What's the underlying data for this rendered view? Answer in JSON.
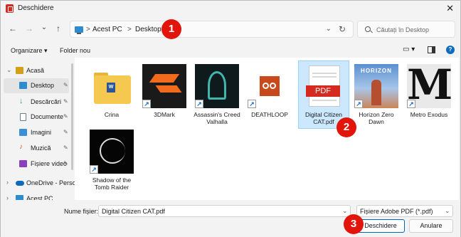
{
  "window": {
    "title": "Deschidere",
    "close_glyph": "✕"
  },
  "nav": {
    "back": "←",
    "forward": "→",
    "recent": "⌄",
    "up": "↑"
  },
  "address": {
    "crumbs": [
      "Acest PC",
      "Desktop"
    ],
    "sep": ">",
    "dropdown": "⌄",
    "refresh": "↻"
  },
  "search": {
    "placeholder": "Căutați în Desktop"
  },
  "toolbar": {
    "organize": "Organizare ▾",
    "new_folder": "Folder nou",
    "view_glyph": "▭ ▾",
    "help_glyph": "?"
  },
  "badges": [
    "1",
    "2",
    "3"
  ],
  "sidebar": {
    "items": [
      {
        "label": "Acasă",
        "icon": "home-icon",
        "color": "#d4a017"
      },
      {
        "label": "Desktop",
        "icon": "desktop-folder-icon",
        "color": "#2c8ccf",
        "selected": true
      },
      {
        "label": "Descărcări",
        "icon": "downloads-icon",
        "color": "#2f9e5b"
      },
      {
        "label": "Documente",
        "icon": "documents-icon",
        "color": "#6a7b8c"
      },
      {
        "label": "Imagini",
        "icon": "pictures-icon",
        "color": "#3a8fd6"
      },
      {
        "label": "Muzică",
        "icon": "music-icon",
        "color": "#e0601f"
      },
      {
        "label": "Fișiere video",
        "icon": "videos-icon",
        "color": "#8a3fbf"
      },
      {
        "label": "OneDrive - Perso",
        "icon": "onedrive-icon",
        "color": "#0f6cbd"
      },
      {
        "label": "Acest PC",
        "icon": "pc-icon",
        "color": "#2c8ccf"
      }
    ],
    "pin_glyph": "📌"
  },
  "files": [
    {
      "name": "Crina",
      "type": "folder"
    },
    {
      "name": "3DMark",
      "type": "shortcut"
    },
    {
      "name": "Assassin's Creed Valhalla",
      "type": "shortcut"
    },
    {
      "name": "DEATHLOOP",
      "type": "shortcut"
    },
    {
      "name": "Digital Citizen CAT.pdf",
      "type": "pdf",
      "selected": true,
      "thumb_text": "PDF"
    },
    {
      "name": "Horizon Zero Dawn",
      "type": "shortcut",
      "thumb_text": "HORIZON"
    },
    {
      "name": "Metro Exodus",
      "type": "shortcut",
      "thumb_text": "M"
    },
    {
      "name": "Shadow of the Tomb Raider",
      "type": "shortcut"
    }
  ],
  "footer": {
    "filename_label": "Nume fișier:",
    "filename_value": "Digital Citizen CAT.pdf",
    "filetype": "Fișiere Adobe PDF (*.pdf)",
    "open": "Deschidere",
    "cancel": "Anulare",
    "drop_glyph": "⌄"
  }
}
